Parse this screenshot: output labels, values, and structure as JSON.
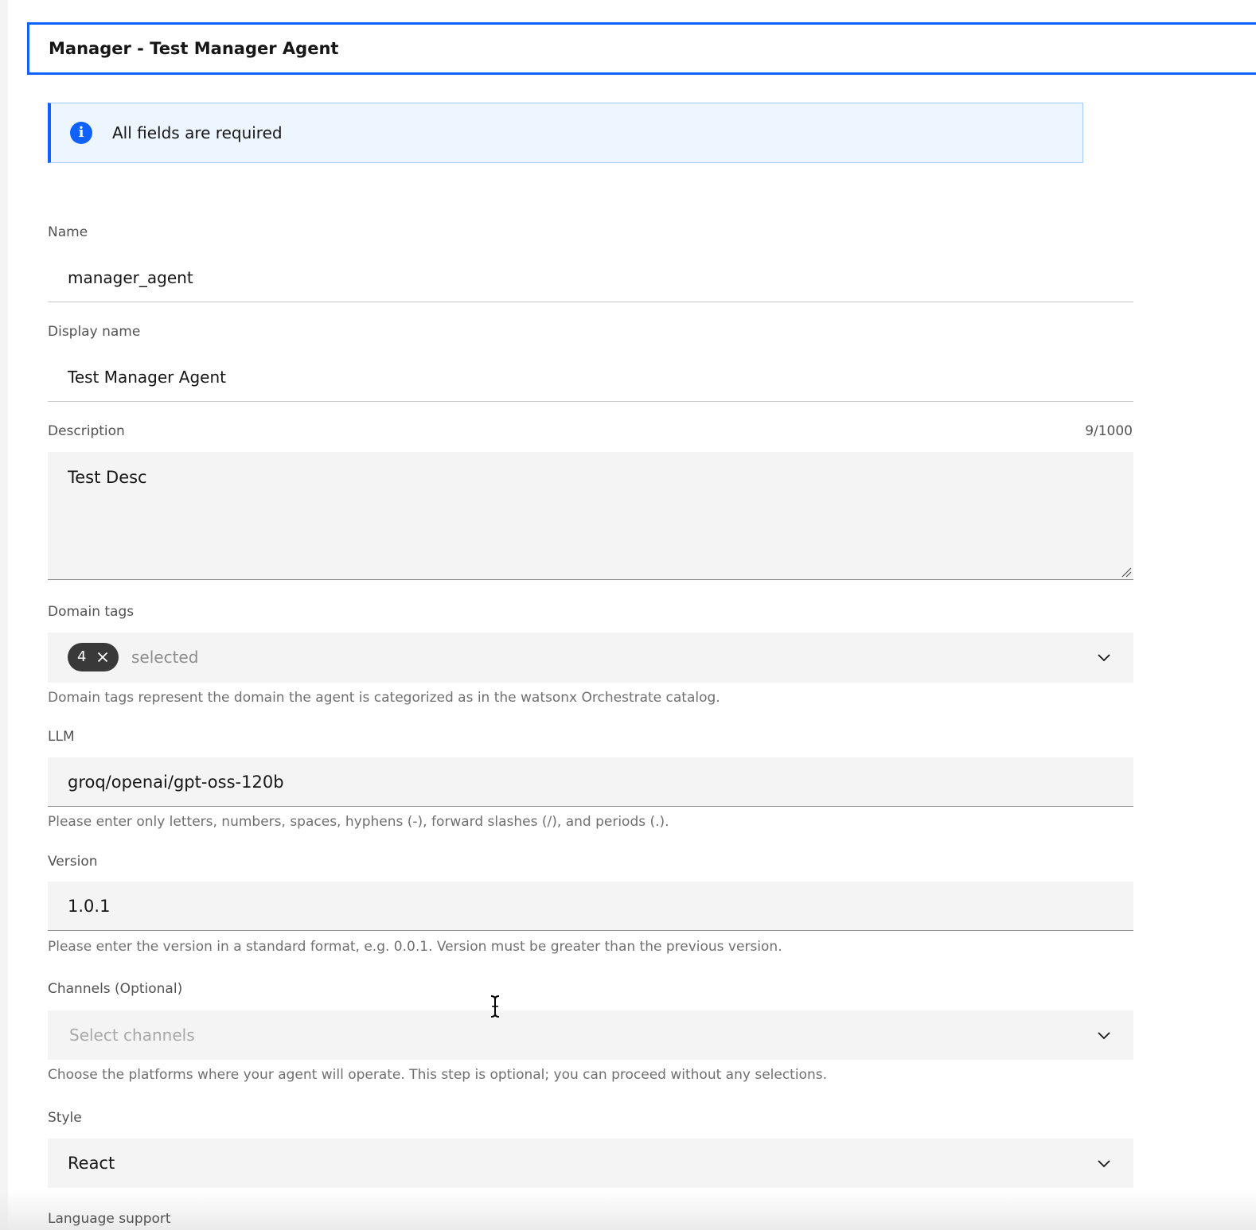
{
  "header": {
    "title": "Manager - Test Manager Agent"
  },
  "notice": {
    "icon": "info-icon",
    "text": "All fields are required",
    "accent_color": "#0f62fe",
    "background": "#edf5ff"
  },
  "form": {
    "name": {
      "label": "Name",
      "value": "manager_agent"
    },
    "display_name": {
      "label": "Display name",
      "value": "Test Manager Agent"
    },
    "description": {
      "label": "Description",
      "counter": "9/1000",
      "value": "Test Desc"
    },
    "domain_tags": {
      "label": "Domain tags",
      "selected_count": "4",
      "selected_text": "selected",
      "helper": "Domain tags represent the domain the agent is categorized as in the watsonx Orchestrate catalog."
    },
    "llm": {
      "label": "LLM",
      "value": "groq/openai/gpt-oss-120b",
      "helper": "Please enter only letters, numbers, spaces, hyphens (-), forward slashes (/), and periods (.)."
    },
    "version": {
      "label": "Version",
      "value": "1.0.1",
      "helper": "Please enter the version in a standard format, e.g. 0.0.1. Version must be greater than the previous version."
    },
    "channels": {
      "label": "Channels (Optional)",
      "placeholder": "Select channels",
      "helper": "Choose the platforms where your agent will operate. This step is optional; you can proceed without any selections."
    },
    "style": {
      "label": "Style",
      "value": "React"
    },
    "language_support": {
      "label": "Language support"
    }
  }
}
